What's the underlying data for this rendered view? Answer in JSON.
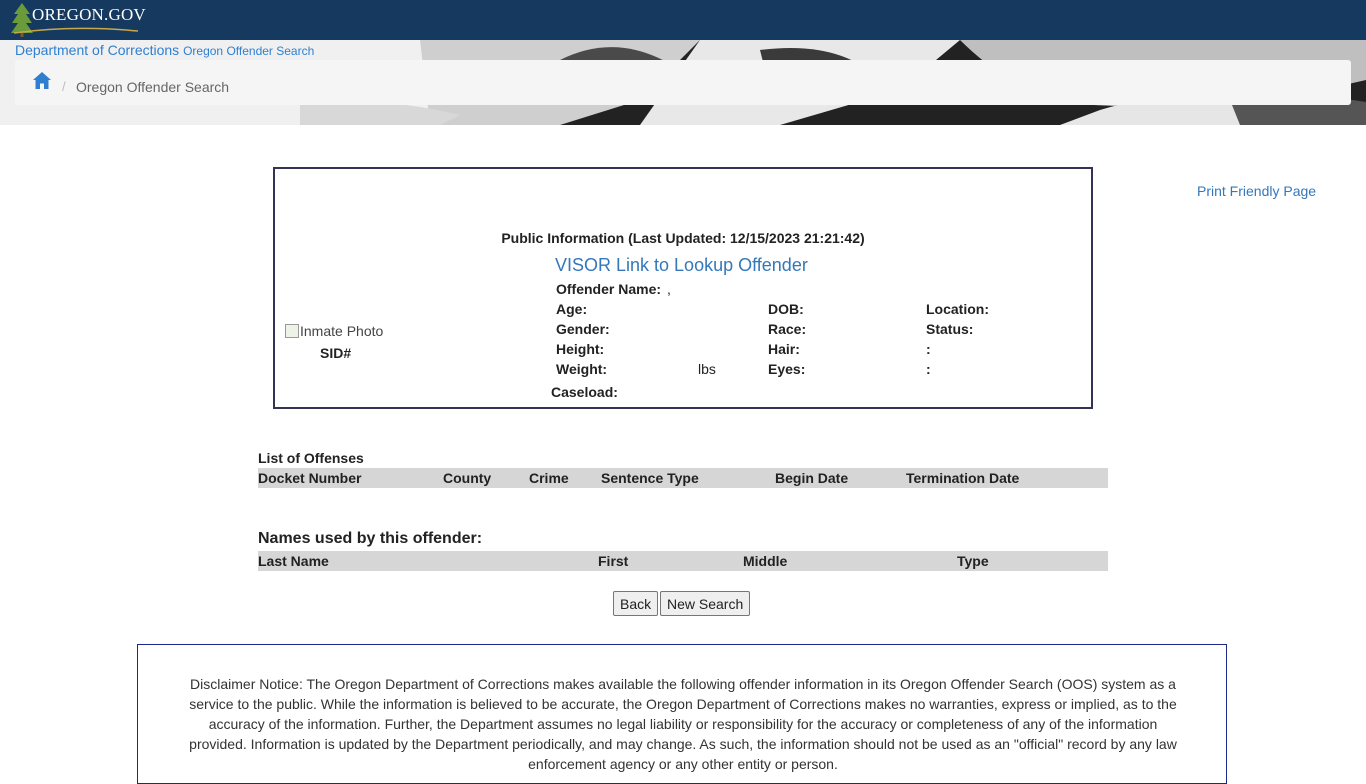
{
  "header": {
    "logo_text": "OREGON.GOV",
    "dept_name": "Department of Corrections",
    "dept_sub": "Oregon Offender Search",
    "brand_color": "#163a5f"
  },
  "breadcrumb": {
    "home_icon": "home-icon",
    "separator": "/",
    "current": "Oregon Offender Search"
  },
  "print_link": "Print Friendly Page",
  "card": {
    "title": "Public Information (Last Updated: 12/15/2023 21:21:42)",
    "visor_link": "VISOR Link to Lookup Offender",
    "photo_alt": "Inmate Photo",
    "sid_label": "SID#",
    "offender_name_label": "Offender Name:",
    "offender_name_value": ",",
    "age_label": "Age:",
    "dob_label": "DOB:",
    "location_label": "Location:",
    "gender_label": "Gender:",
    "race_label": "Race:",
    "status_label": "Status:",
    "height_label": "Height:",
    "hair_label": "Hair:",
    "colon1": ":",
    "weight_label": "Weight:",
    "weight_unit": "lbs",
    "eyes_label": "Eyes:",
    "colon2": ":",
    "caseload_label": "Caseload:"
  },
  "offenses": {
    "title": "List of Offenses",
    "columns": [
      "Docket Number",
      "County",
      "Crime",
      "Sentence Type",
      "Begin Date",
      "Termination Date"
    ],
    "rows": []
  },
  "names": {
    "title": "Names used by this offender:",
    "columns": [
      "Last Name",
      "First",
      "Middle",
      "Type"
    ],
    "rows": []
  },
  "buttons": {
    "back": "Back",
    "new_search": "New Search"
  },
  "disclaimer": "Disclaimer Notice: The Oregon Department of Corrections makes available the following offender information in its Oregon Offender Search (OOS) system as a service to the public. While the information is believed to be accurate, the Oregon Department of Corrections makes no warranties, express or implied, as to the accuracy of the information. Further, the Department assumes no legal liability or responsibility for the accuracy or completeness of any of the information provided. Information is updated by the Department periodically, and may change. As such, the information should not be used as an \"official\" record by any law enforcement agency or any other entity or person."
}
